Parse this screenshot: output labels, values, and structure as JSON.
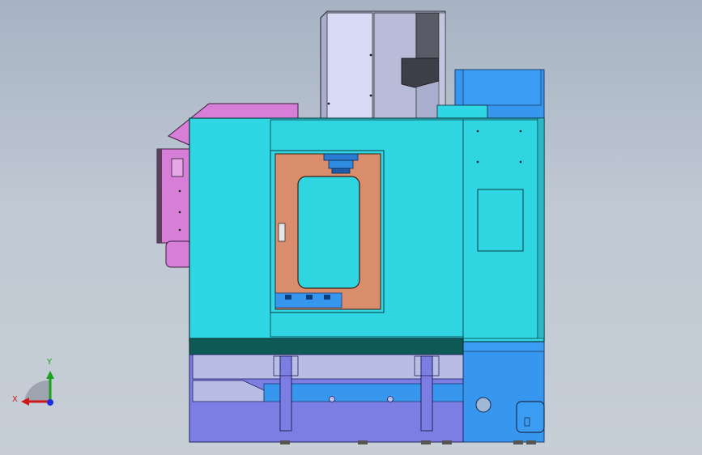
{
  "viewport": {
    "background_top": "#a7b3c3",
    "background_bottom": "#c7ced6"
  },
  "model": {
    "colors": {
      "cabinet": "#2fd6e3",
      "door_frame": "#d98d6c",
      "motor_housing": "#a5a9c4",
      "motor_housing_light": "#d7d9f5",
      "side_panel": "#d77fd8",
      "electrical_cabinet": "#3796ee",
      "base": "#7d7ee4",
      "base_light": "#b8bde6",
      "dark_band": "#0f5a57",
      "spindle": "#2a7cd1",
      "leveling_feet": "#555555"
    }
  },
  "triad": {
    "x_label": "X",
    "y_label": "Y",
    "x_color": "#d01818",
    "y_color": "#1aa11a",
    "z_color": "#1a2ee0"
  }
}
